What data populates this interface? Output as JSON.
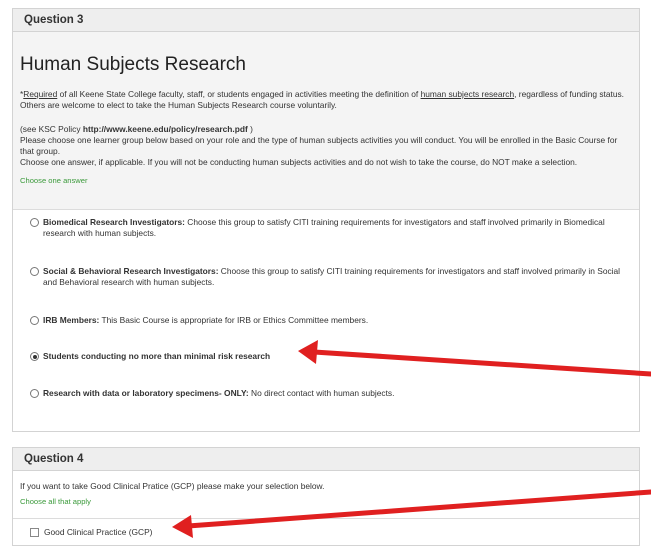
{
  "q3": {
    "header": "Question 3",
    "title": "Human Subjects Research",
    "req_star": "*",
    "req_required": "Required",
    "req_mid": " of all Keene State College faculty, staff, or students engaged in activities meeting the definition of ",
    "req_link": "human subjects research",
    "req_end": ", regardless of funding status. Others are welcome to elect to take the Human Subjects Research course voluntarily.",
    "policy_prefix": "(see KSC Policy ",
    "policy_link": "http://www.keene.edu/policy/research.pdf",
    "policy_suffix": " )",
    "instr1": "Please choose one learner group below based on your role and the type of human subjects activities you will conduct. You will be enrolled in the Basic Course for that group.",
    "instr2": "Choose one answer, if applicable. If you will not be conducting human subjects activities and do not wish to take the course, do NOT make a selection.",
    "hint": "Choose one answer",
    "options": [
      {
        "bold": "Biomedical Research Investigators:",
        "text": " Choose this group to satisfy CITI training requirements for investigators and staff involved primarily in Biomedical research with human subjects.",
        "selected": false
      },
      {
        "bold": "Social & Behavioral Research Investigators:",
        "text": " Choose this group to satisfy CITI training requirements for investigators and staff involved primarily in Social and Behavioral research with human subjects.",
        "selected": false
      },
      {
        "bold": "IRB Members:",
        "text": " This Basic Course is appropriate for IRB or Ethics Committee members.",
        "selected": false
      },
      {
        "bold": "Students conducting no more than minimal risk research",
        "text": "",
        "selected": true
      },
      {
        "bold": "Research with data or laboratory specimens- ONLY:",
        "text": " No direct contact with human subjects.",
        "selected": false
      }
    ]
  },
  "q4": {
    "header": "Question 4",
    "text": "If you want to take Good Clinical Pratice (GCP) please make your selection below.",
    "hint": "Choose all that apply",
    "checkbox_label": "Good Clinical Practice (GCP)",
    "checked": false
  },
  "annotation_color": "#e02020"
}
